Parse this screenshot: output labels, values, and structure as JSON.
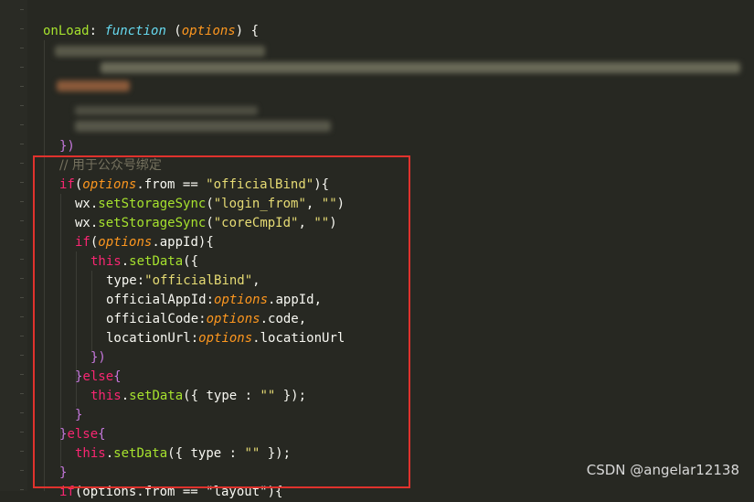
{
  "code": {
    "line_onload": {
      "name": "onLoad",
      "colon": ": ",
      "keyword": "function",
      "paren_open": " (",
      "param": "options",
      "paren_close": ") {"
    },
    "line_close_obj": "})",
    "comment": "// 用于公众号绑定",
    "if_from": {
      "kw": "if",
      "open": "(",
      "param": "options",
      "rest1": ".from == ",
      "str": "\"officialBind\"",
      "rest2": "){"
    },
    "storage1": {
      "obj": "wx.",
      "method": "setStorageSync",
      "open": "(",
      "arg1": "\"login_from\"",
      "sep": ", ",
      "arg2": "\"\"",
      "close": ")"
    },
    "storage2": {
      "obj": "wx.",
      "method": "setStorageSync",
      "open": "(",
      "arg1": "\"coreCmpId\"",
      "sep": ", ",
      "arg2": "\"\"",
      "close": ")"
    },
    "if_appid": {
      "kw": "if",
      "open": "(",
      "param": "options",
      "rest": ".appId){"
    },
    "setdata_open": {
      "this": "this",
      "dot": ".",
      "method": "setData",
      "rest": "({"
    },
    "type_line": {
      "key": "type:",
      "str": "\"officialBind\"",
      "comma": ","
    },
    "appid_line": {
      "key": "officialAppId:",
      "param": "options",
      "rest": ".appId,"
    },
    "code_line": {
      "key": "officialCode:",
      "param": "options",
      "rest": ".code,"
    },
    "url_line": {
      "key": "locationUrl:",
      "param": "options",
      "rest": ".locationUrl"
    },
    "setdata_close": "})",
    "else1": {
      "close": "}",
      "kw": "else",
      "open": "{"
    },
    "setdata_empty1": {
      "this": "this",
      "dot": ".",
      "method": "setData",
      "rest1": "({ type : ",
      "str": "\"\"",
      "rest2": " });"
    },
    "close_brace1": "}",
    "else2": {
      "close": "}",
      "kw": "else",
      "open": "{"
    },
    "setdata_empty2": {
      "this": "this",
      "dot": ".",
      "method": "setData",
      "rest1": "({ type : ",
      "str": "\"\"",
      "rest2": " });"
    },
    "close_brace2": "}",
    "partial": {
      "kw": "if",
      "rest": "(options.from == \"layout\"){"
    }
  },
  "watermark": "CSDN @angelar12138",
  "colors": {
    "background": "#272822",
    "highlight_border": "#e0322d"
  }
}
